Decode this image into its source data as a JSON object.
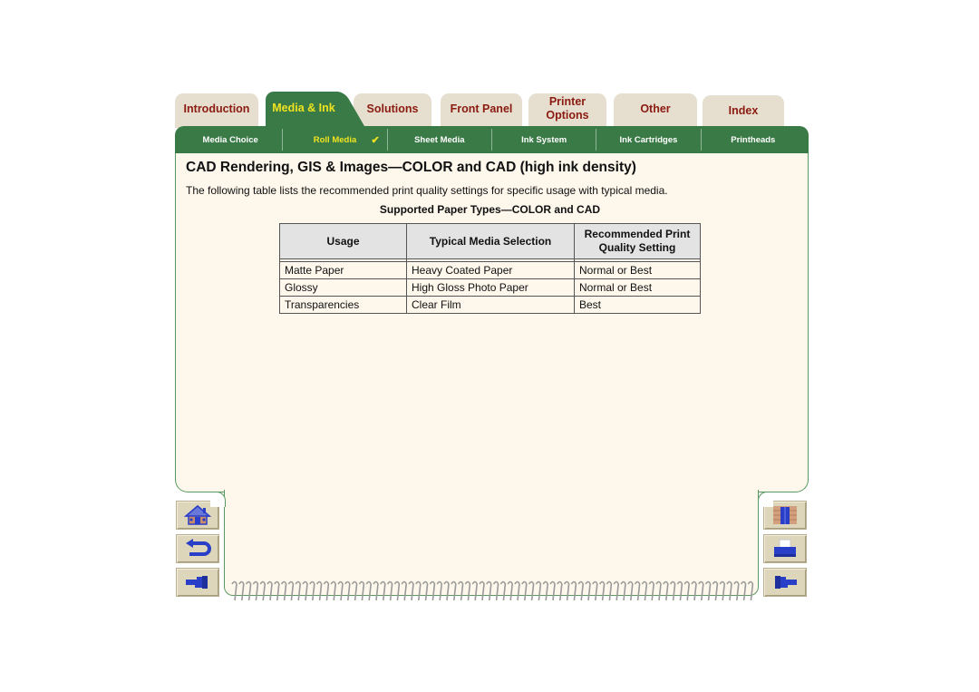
{
  "tabs": [
    {
      "label": "Introduction",
      "active": false
    },
    {
      "label": "Media & Ink",
      "active": true
    },
    {
      "label": "Solutions",
      "active": false
    },
    {
      "label": "Front Panel",
      "active": false
    },
    {
      "label": "Printer Options",
      "active": false
    },
    {
      "label": "Other",
      "active": false
    },
    {
      "label": "Index",
      "active": false
    }
  ],
  "subnav": [
    {
      "label": "Media Choice",
      "active": false
    },
    {
      "label": "Roll Media",
      "active": true,
      "icon": "checkmark-icon"
    },
    {
      "label": "Sheet Media",
      "active": false
    },
    {
      "label": "Ink System",
      "active": false
    },
    {
      "label": "Ink Cartridges",
      "active": false
    },
    {
      "label": "Printheads",
      "active": false
    }
  ],
  "content": {
    "title": "CAD Rendering, GIS & Images—COLOR and CAD (high ink density)",
    "intro": "The following table lists the recommended print quality settings for specific usage with typical media.",
    "table_title": "Supported Paper Types—COLOR and CAD",
    "table": {
      "headers": [
        "Usage",
        "Typical Media Selection",
        "Recommended Print Quality Setting"
      ],
      "rows": [
        [
          "Matte Paper",
          "Heavy Coated Paper",
          "Normal or Best"
        ],
        [
          "Glossy",
          "High Gloss Photo Paper",
          "Normal or Best"
        ],
        [
          "Transparencies",
          "Clear Film",
          "Best"
        ]
      ]
    }
  },
  "nav_buttons": {
    "left": [
      "home-icon",
      "back-icon",
      "previous-page-icon"
    ],
    "right": [
      "exit-door-icon",
      "print-icon",
      "next-page-icon"
    ]
  },
  "colors": {
    "accent_green": "#3a7a46",
    "active_text": "#f0e320",
    "tab_text": "#8b1a10",
    "tab_bg": "#e6dfcf",
    "panel_bg": "#fdf7ec"
  }
}
